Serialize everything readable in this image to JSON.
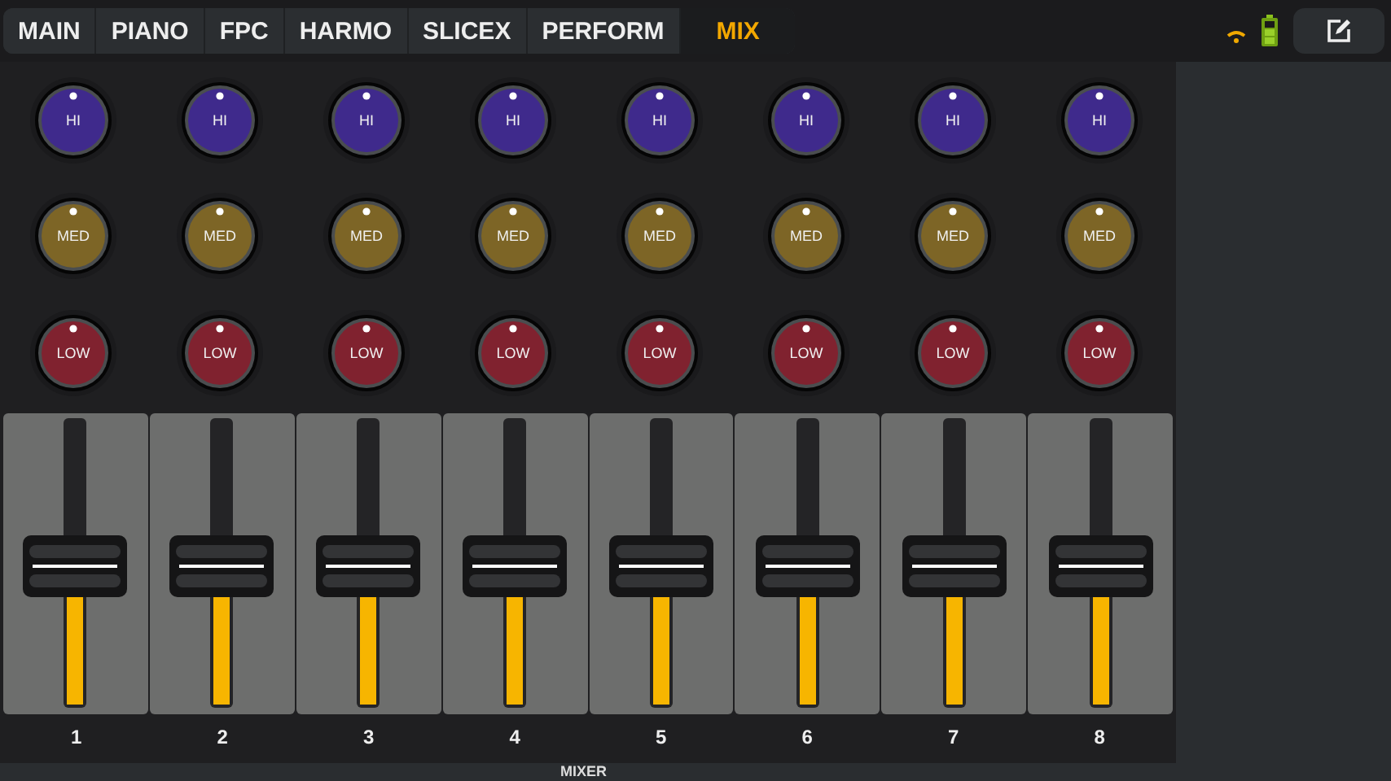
{
  "tabs": [
    {
      "label": "MAIN",
      "selected": false
    },
    {
      "label": "PIANO",
      "selected": false
    },
    {
      "label": "FPC",
      "selected": false
    },
    {
      "label": "HARMO",
      "selected": false
    },
    {
      "label": "SLICEX",
      "selected": false
    },
    {
      "label": "PERFORM",
      "selected": false
    },
    {
      "label": "MIX",
      "selected": true
    }
  ],
  "channels": [
    {
      "number": "1",
      "knobs": [
        {
          "kind": "hi",
          "label": "HI",
          "level": 0.5
        },
        {
          "kind": "med",
          "label": "MED",
          "level": 0.5
        },
        {
          "kind": "low",
          "label": "LOW",
          "level": 0.5
        }
      ],
      "level": 0.5
    },
    {
      "number": "2",
      "knobs": [
        {
          "kind": "hi",
          "label": "HI",
          "level": 0.5
        },
        {
          "kind": "med",
          "label": "MED",
          "level": 0.5
        },
        {
          "kind": "low",
          "label": "LOW",
          "level": 0.5
        }
      ],
      "level": 0.5
    },
    {
      "number": "3",
      "knobs": [
        {
          "kind": "hi",
          "label": "HI",
          "level": 0.5
        },
        {
          "kind": "med",
          "label": "MED",
          "level": 0.5
        },
        {
          "kind": "low",
          "label": "LOW",
          "level": 0.5
        }
      ],
      "level": 0.5
    },
    {
      "number": "4",
      "knobs": [
        {
          "kind": "hi",
          "label": "HI",
          "level": 0.5
        },
        {
          "kind": "med",
          "label": "MED",
          "level": 0.5
        },
        {
          "kind": "low",
          "label": "LOW",
          "level": 0.5
        }
      ],
      "level": 0.5
    },
    {
      "number": "5",
      "knobs": [
        {
          "kind": "hi",
          "label": "HI",
          "level": 0.5
        },
        {
          "kind": "med",
          "label": "MED",
          "level": 0.5
        },
        {
          "kind": "low",
          "label": "LOW",
          "level": 0.5
        }
      ],
      "level": 0.5
    },
    {
      "number": "6",
      "knobs": [
        {
          "kind": "hi",
          "label": "HI",
          "level": 0.5
        },
        {
          "kind": "med",
          "label": "MED",
          "level": 0.5
        },
        {
          "kind": "low",
          "label": "LOW",
          "level": 0.5
        }
      ],
      "level": 0.5
    },
    {
      "number": "7",
      "knobs": [
        {
          "kind": "hi",
          "label": "HI",
          "level": 0.5
        },
        {
          "kind": "med",
          "label": "MED",
          "level": 0.5
        },
        {
          "kind": "low",
          "label": "LOW",
          "level": 0.5
        }
      ],
      "level": 0.5
    },
    {
      "number": "8",
      "knobs": [
        {
          "kind": "hi",
          "label": "HI",
          "level": 0.5
        },
        {
          "kind": "med",
          "label": "MED",
          "level": 0.5
        },
        {
          "kind": "low",
          "label": "LOW",
          "level": 0.5
        }
      ],
      "level": 0.5
    }
  ],
  "footer": "MIXER"
}
